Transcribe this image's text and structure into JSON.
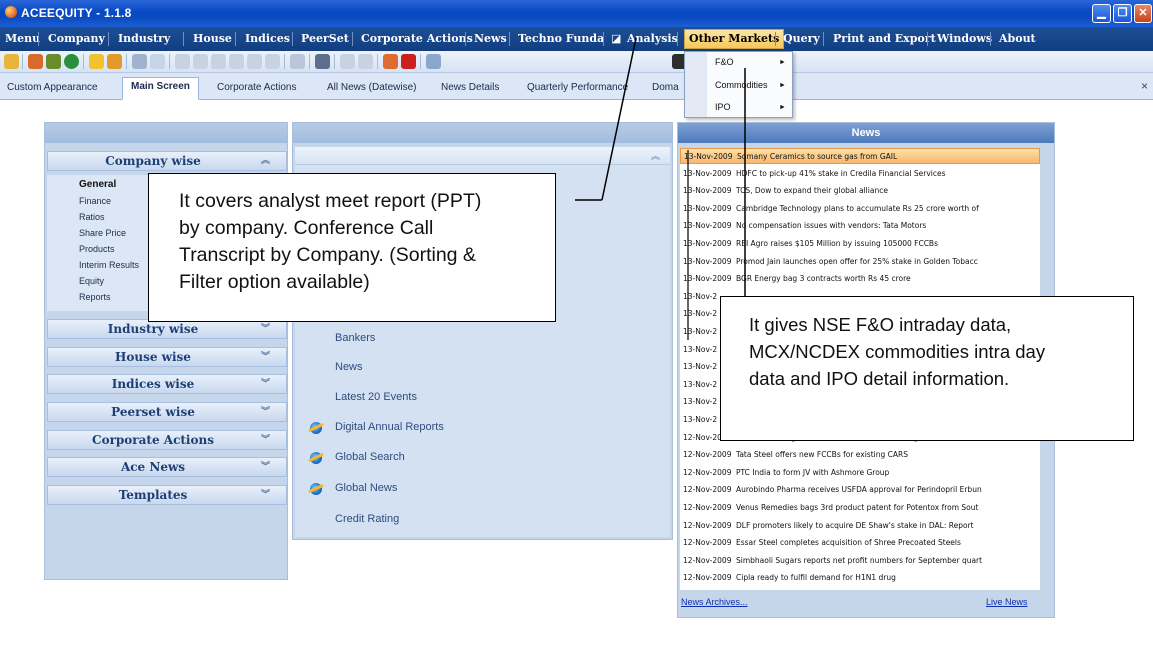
{
  "window": {
    "title": "ACEEQUITY  - 1.1.8"
  },
  "menu": {
    "items": [
      "Menu",
      "Company",
      "Industry",
      "House",
      "Indices",
      "PeerSet",
      "Corporate Actions",
      "News",
      "Techno Funda",
      "Analysis",
      "Other Markets",
      "Query",
      "Print and Export",
      "Windows",
      "About"
    ],
    "active": "Other Markets"
  },
  "tabs": {
    "items": [
      "Custom Appearance",
      "Main Screen",
      "Corporate Actions",
      "All News (Datewise)",
      "News Details",
      "Quarterly Performance",
      "Doma"
    ],
    "active": "Main Screen",
    "close": "×"
  },
  "dropdown": {
    "items": [
      {
        "label": "F&O",
        "arrow": "►"
      },
      {
        "label": "Commodities",
        "arrow": "►"
      },
      {
        "label": "IPO",
        "arrow": "►"
      }
    ]
  },
  "left_panel": {
    "groups": [
      "Company wise",
      "Industry wise",
      "House wise",
      "Indices wise",
      "Peerset wise",
      "Corporate Actions",
      "Ace News",
      "Templates"
    ],
    "company_items": [
      "General",
      "Finance",
      "Ratios",
      "Share Price",
      "Products",
      "Interim Results",
      "Equity",
      "Reports"
    ],
    "chev_up": "≈",
    "chev_down": "≈"
  },
  "middle_panel": {
    "items": [
      "Bankers",
      "News",
      "Latest 20 Events",
      "Digital Annual Reports",
      "Global Search",
      "Global News",
      "Credit Rating"
    ]
  },
  "news_panel": {
    "title": "News",
    "rows": [
      {
        "date": "13-Nov-2009",
        "text": "Somany Ceramics to source gas from GAIL"
      },
      {
        "date": "13-Nov-2009",
        "text": "HDFC to pick-up 41% stake in Credila Financial Services"
      },
      {
        "date": "13-Nov-2009",
        "text": "TCS, Dow to expand their global alliance"
      },
      {
        "date": "13-Nov-2009",
        "text": "Cambridge Technology plans to accumulate Rs 25 crore worth of"
      },
      {
        "date": "13-Nov-2009",
        "text": "No compensation issues with vendors: Tata Motors"
      },
      {
        "date": "13-Nov-2009",
        "text": "REI Agro raises $105 Million by issuing 105000 FCCBs"
      },
      {
        "date": "13-Nov-2009",
        "text": "Promod Jain launches open offer for 25% stake in Golden Tobacc"
      },
      {
        "date": "13-Nov-2009",
        "text": "BGR Energy bag 3 contracts worth Rs 45 crore"
      },
      {
        "date": "13-Nov-2",
        "text": ""
      },
      {
        "date": "13-Nov-2",
        "text": ""
      },
      {
        "date": "13-Nov-2",
        "text": ""
      },
      {
        "date": "13-Nov-2",
        "text": ""
      },
      {
        "date": "13-Nov-2",
        "text": ""
      },
      {
        "date": "13-Nov-2",
        "text": ""
      },
      {
        "date": "13-Nov-2",
        "text": ""
      },
      {
        "date": "13-Nov-2",
        "text": ""
      },
      {
        "date": "12-Nov-2009",
        "text": "Vallabh Steels gets HC nod for scheme of arrangement"
      },
      {
        "date": "12-Nov-2009",
        "text": "Tata Steel offers new FCCBs for existing CARS"
      },
      {
        "date": "12-Nov-2009",
        "text": "PTC India to form JV with Ashmore Group"
      },
      {
        "date": "12-Nov-2009",
        "text": "Aurobindo Pharma receives USFDA approval for Perindopril Erbun"
      },
      {
        "date": "12-Nov-2009",
        "text": "Venus Remedies bags 3rd product patent for Potentox from Sout"
      },
      {
        "date": "12-Nov-2009",
        "text": "DLF promoters likely to acquire DE Shaw's stake in DAL: Report"
      },
      {
        "date": "12-Nov-2009",
        "text": "Essar Steel completes acquisition of Shree Precoated Steels"
      },
      {
        "date": "12-Nov-2009",
        "text": "Simbhaoli Sugars reports net profit numbers for September quart"
      },
      {
        "date": "12-Nov-2009",
        "text": "Cipla ready to fulfil demand for H1N1 drug"
      }
    ],
    "archives": "News Archives...",
    "live": "Live News"
  },
  "callouts": {
    "analysis": [
      "It covers analyst meet report (PPT)",
      "by company. Conference Call",
      "Transcript by Company. (Sorting &",
      "Filter option available)"
    ],
    "other_markets": [
      "It gives NSE F&O intraday data,",
      "MCX/NCDEX commodities intra day",
      "data and IPO detail information."
    ]
  },
  "colors": {
    "menu_bg": "#1d4e96",
    "active_menu": "#f6c75b",
    "news_header": "#4e79bb",
    "selected_row": "#f8b870"
  }
}
